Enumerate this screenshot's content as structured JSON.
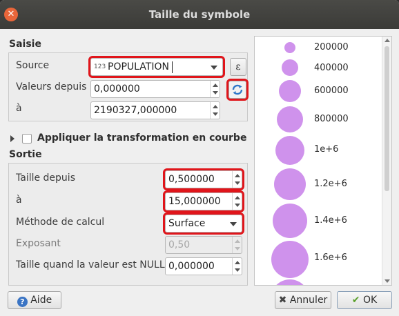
{
  "window": {
    "title": "Taille du symbole"
  },
  "saisie": {
    "title": "Saisie",
    "source_label": "Source",
    "source_type_prefix": "123",
    "source_value": "POPULATION",
    "expression_symbol": "ε",
    "from_label": "Valeurs depuis",
    "from_value": "0,000000",
    "to_label": "à",
    "to_value": "2190327,000000"
  },
  "curve": {
    "label": "Appliquer la transformation en courbe"
  },
  "sortie": {
    "title": "Sortie",
    "size_from_label": "Taille depuis",
    "size_from_value": "0,500000",
    "size_to_label": "à",
    "size_to_value": "15,000000",
    "method_label": "Méthode de calcul",
    "method_value": "Surface",
    "exponent_label": "Exposant",
    "exponent_value": "0,50",
    "null_label": "Taille quand la valeur est NULL",
    "null_value": "0,000000"
  },
  "legend": {
    "items": [
      {
        "label": "200000"
      },
      {
        "label": "400000"
      },
      {
        "label": "600000"
      },
      {
        "label": "800000"
      },
      {
        "label": "1e+6"
      },
      {
        "label": "1.2e+6"
      },
      {
        "label": "1.4e+6"
      },
      {
        "label": "1.6e+6"
      }
    ],
    "circle_color": "#cf92ec"
  },
  "footer": {
    "help_label": "Aide",
    "cancel_label": "Annuler",
    "ok_label": "OK"
  },
  "colors": {
    "highlight": "#e0151b",
    "titlebar": "#3f3f3c",
    "close": "#e9663a"
  }
}
